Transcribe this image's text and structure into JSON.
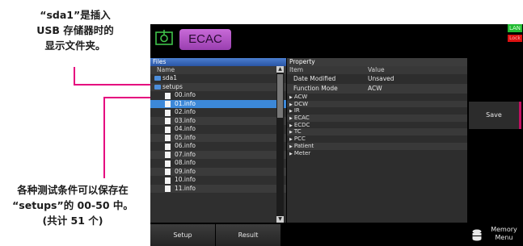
{
  "annotations": {
    "top": [
      "“sda1”是插入",
      "USB 存储器时的",
      "显示文件夹。"
    ],
    "bottom": [
      "各种测试条件可以保存在",
      "“setups”的 00-50 中。",
      "(共计 51 个)"
    ]
  },
  "header": {
    "mode": "ECAC",
    "lan": "LAN",
    "lock": "Lock"
  },
  "files": {
    "pane_title": "Files",
    "column": "Name",
    "folders": [
      "sda1",
      "setups"
    ],
    "items": [
      "00.info",
      "01.info",
      "02.info",
      "03.info",
      "04.info",
      "05.info",
      "06.info",
      "07.info",
      "08.info",
      "09.info",
      "10.info",
      "11.info"
    ],
    "selected": "01.info"
  },
  "property": {
    "pane_title": "Property",
    "col_item": "Item",
    "col_value": "Value",
    "rows": [
      {
        "item": "Date Modified",
        "value": "Unsaved"
      },
      {
        "item": "Function Mode",
        "value": "ACW"
      }
    ],
    "tree": [
      "ACW",
      "DCW",
      "IR",
      "ECAC",
      "ECDC",
      "TC",
      "PCC",
      "Patient",
      "Meter"
    ]
  },
  "buttons": {
    "save": "Save",
    "setup": "Setup",
    "result": "Result",
    "memory_line1": "Memory",
    "memory_line2": "Menu"
  },
  "colors": {
    "accent_line": "#e5007e",
    "selected_row": "#3c88d8",
    "mode_badge": "#b556c8"
  }
}
